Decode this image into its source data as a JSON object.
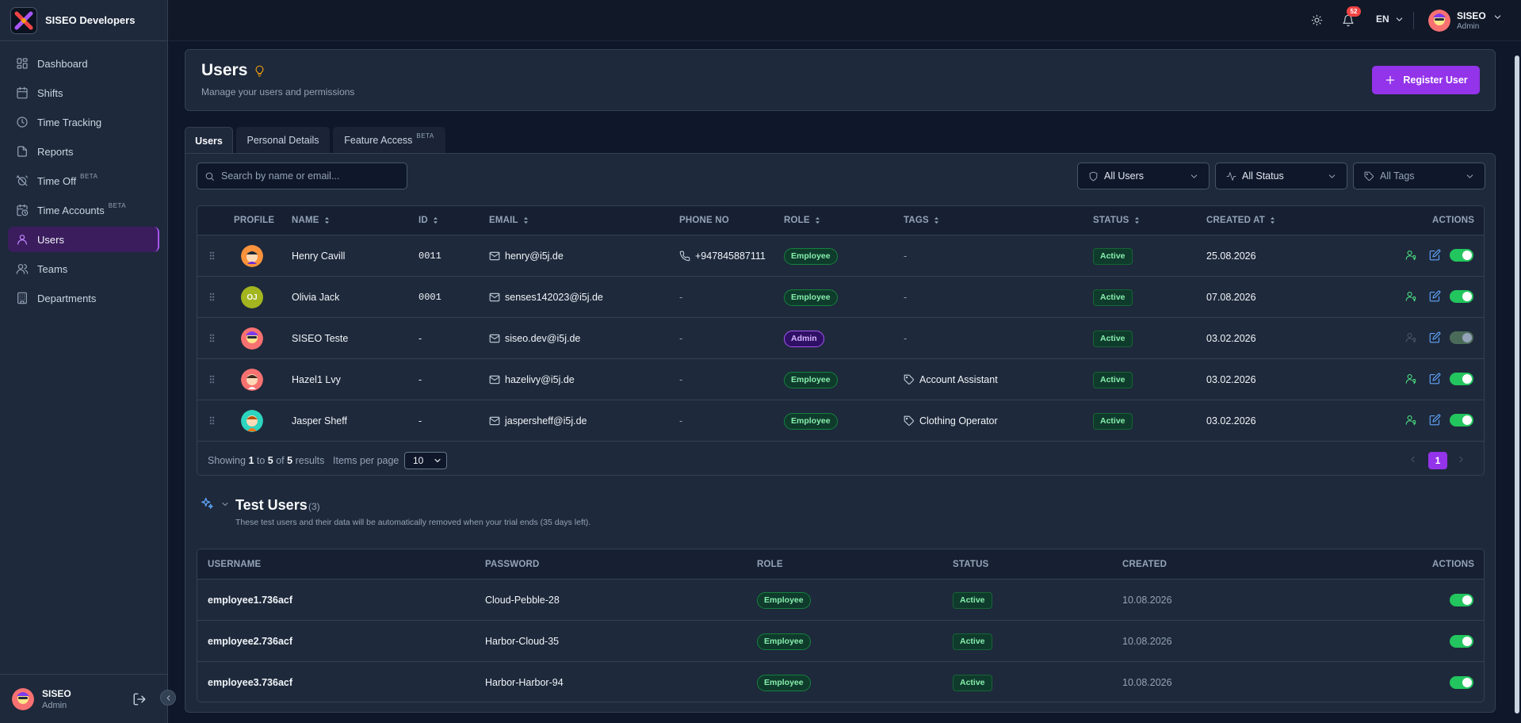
{
  "brand": {
    "name": "SISEO Developers"
  },
  "sidebar": {
    "items": [
      {
        "label": "Dashboard",
        "icon": "dashboard-icon"
      },
      {
        "label": "Shifts",
        "icon": "calendar-icon"
      },
      {
        "label": "Time Tracking",
        "icon": "clock-icon"
      },
      {
        "label": "Reports",
        "icon": "document-icon"
      },
      {
        "label": "Time Off",
        "icon": "alarm-off-icon",
        "badge": "BETA"
      },
      {
        "label": "Time Accounts",
        "icon": "calendar-clock-icon",
        "badge": "BETA"
      },
      {
        "label": "Users",
        "icon": "user-icon",
        "active": true
      },
      {
        "label": "Teams",
        "icon": "users-icon"
      },
      {
        "label": "Departments",
        "icon": "building-icon"
      }
    ],
    "footer": {
      "name": "SISEO",
      "role": "Admin"
    }
  },
  "topbar": {
    "notifications_count": "52",
    "language": "EN",
    "user": {
      "name": "SISEO",
      "role": "Admin"
    }
  },
  "page": {
    "title": "Users",
    "subtitle": "Manage your users and permissions",
    "register_label": "Register User"
  },
  "tabs": [
    {
      "label": "Users",
      "active": true
    },
    {
      "label": "Personal Details"
    },
    {
      "label": "Feature Access",
      "badge": "BETA"
    }
  ],
  "search": {
    "placeholder": "Search by name or email..."
  },
  "filters": {
    "users": "All Users",
    "status": "All Status",
    "tags": "All Tags"
  },
  "users_table": {
    "columns": {
      "profile": "PROFILE",
      "name": "NAME",
      "id": "ID",
      "email": "EMAIL",
      "phone": "PHONE NO",
      "role": "ROLE",
      "tags": "TAGS",
      "status": "STATUS",
      "created": "CREATED AT",
      "actions": "ACTIONS"
    },
    "rows": [
      {
        "name": "Henry Cavill",
        "id": "0011",
        "email": "henry@i5j.de",
        "phone": "+947845887111",
        "role": "Employee",
        "tags": "-",
        "status": "Active",
        "created": "25.08.2026"
      },
      {
        "name": "Olivia Jack",
        "initials": "OJ",
        "id": "0001",
        "email": "senses142023@i5j.de",
        "phone": "-",
        "role": "Employee",
        "tags": "-",
        "status": "Active",
        "created": "07.08.2026"
      },
      {
        "name": "SISEO Teste",
        "id": "-",
        "email": "siseo.dev@i5j.de",
        "phone": "-",
        "role": "Admin",
        "tags": "-",
        "status": "Active",
        "created": "03.02.2026"
      },
      {
        "name": "Hazel1 Lvy",
        "id": "-",
        "email": "hazelivy@i5j.de",
        "phone": "-",
        "role": "Employee",
        "tags": "Account Assistant",
        "status": "Active",
        "created": "03.02.2026"
      },
      {
        "name": "Jasper Sheff",
        "id": "-",
        "email": "jaspersheff@i5j.de",
        "phone": "-",
        "role": "Employee",
        "tags": "Clothing Operator",
        "status": "Active",
        "created": "03.02.2026"
      }
    ]
  },
  "pagination": {
    "showing_prefix": "Showing",
    "from": "1",
    "to_word": "to",
    "to": "5",
    "of_word": "of",
    "total": "5",
    "results_word": "results",
    "items_per_page_label": "Items per page",
    "items_per_page": "10",
    "current_page": "1"
  },
  "test_users": {
    "title": "Test Users",
    "count": "(3)",
    "note": "These test users and their data will be automatically removed when your trial ends (35 days left).",
    "columns": {
      "username": "USERNAME",
      "password": "PASSWORD",
      "role": "ROLE",
      "status": "STATUS",
      "created": "CREATED",
      "actions": "ACTIONS"
    },
    "rows": [
      {
        "username": "employee1.736acf",
        "password": "Cloud-Pebble-28",
        "role": "Employee",
        "status": "Active",
        "created": "10.08.2026"
      },
      {
        "username": "employee2.736acf",
        "password": "Harbor-Cloud-35",
        "role": "Employee",
        "status": "Active",
        "created": "10.08.2026"
      },
      {
        "username": "employee3.736acf",
        "password": "Harbor-Harbor-94",
        "role": "Employee",
        "status": "Active",
        "created": "10.08.2026"
      }
    ]
  },
  "colors": {
    "accent": "#9333ea",
    "success": "#22c55e",
    "background": "#0f172a",
    "surface": "#1e293b"
  }
}
